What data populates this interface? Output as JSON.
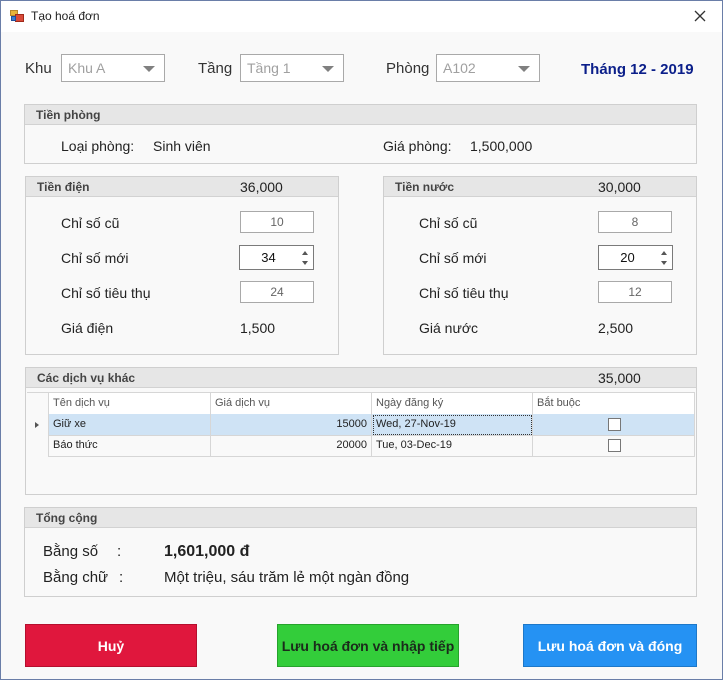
{
  "window": {
    "title": "Tạo hoá đơn"
  },
  "filters": {
    "khu_label": "Khu",
    "khu_value": "Khu A",
    "tang_label": "Tầng",
    "tang_value": "Tầng 1",
    "phong_label": "Phòng",
    "phong_value": "A102",
    "month": "Tháng 12 - 2019"
  },
  "room": {
    "title": "Tiền phòng",
    "type_label": "Loại phòng:",
    "type_value": "Sinh viên",
    "price_label": "Giá phòng:",
    "price_value": "1,500,000"
  },
  "electric": {
    "title": "Tiền điện",
    "total": "36,000",
    "old_label": "Chỉ số cũ",
    "old_value": "10",
    "new_label": "Chỉ số mới",
    "new_value": "34",
    "usage_label": "Chỉ số tiêu thụ",
    "usage_value": "24",
    "price_label": "Giá điện",
    "price_value": "1,500"
  },
  "water": {
    "title": "Tiền nước",
    "total": "30,000",
    "old_label": "Chỉ số cũ",
    "old_value": "8",
    "new_label": "Chỉ số mới",
    "new_value": "20",
    "usage_label": "Chỉ số tiêu thụ",
    "usage_value": "12",
    "price_label": "Giá nước",
    "price_value": "2,500"
  },
  "services": {
    "title": "Các dịch vụ khác",
    "total": "35,000",
    "columns": [
      "Tên dịch vụ",
      "Giá dịch vụ",
      "Ngày đăng ký",
      "Bắt buộc"
    ],
    "rows": [
      {
        "name": "Giữ xe",
        "price": "15000",
        "date": "Wed, 27-Nov-19",
        "required": false
      },
      {
        "name": "Báo thức",
        "price": "20000",
        "date": "Tue, 03-Dec-19",
        "required": false
      }
    ]
  },
  "total": {
    "title": "Tổng cộng",
    "num_label": "Bằng số",
    "num_colon": ":",
    "num_value": "1,601,000 đ",
    "text_label": "Bằng chữ",
    "text_colon": ":",
    "text_value": "Một triệu, sáu trăm lẻ một ngàn đồng"
  },
  "buttons": {
    "cancel": "Huỷ",
    "save_next": "Lưu hoá đơn và nhập tiếp",
    "save_close": "Lưu hoá đơn và đóng"
  },
  "colors": {
    "cancel": "#e0173d",
    "save_next": "#33cd3a",
    "save_close": "#2592f3",
    "month": "#0b1f8a",
    "selected_row": "#cfe3f5"
  }
}
